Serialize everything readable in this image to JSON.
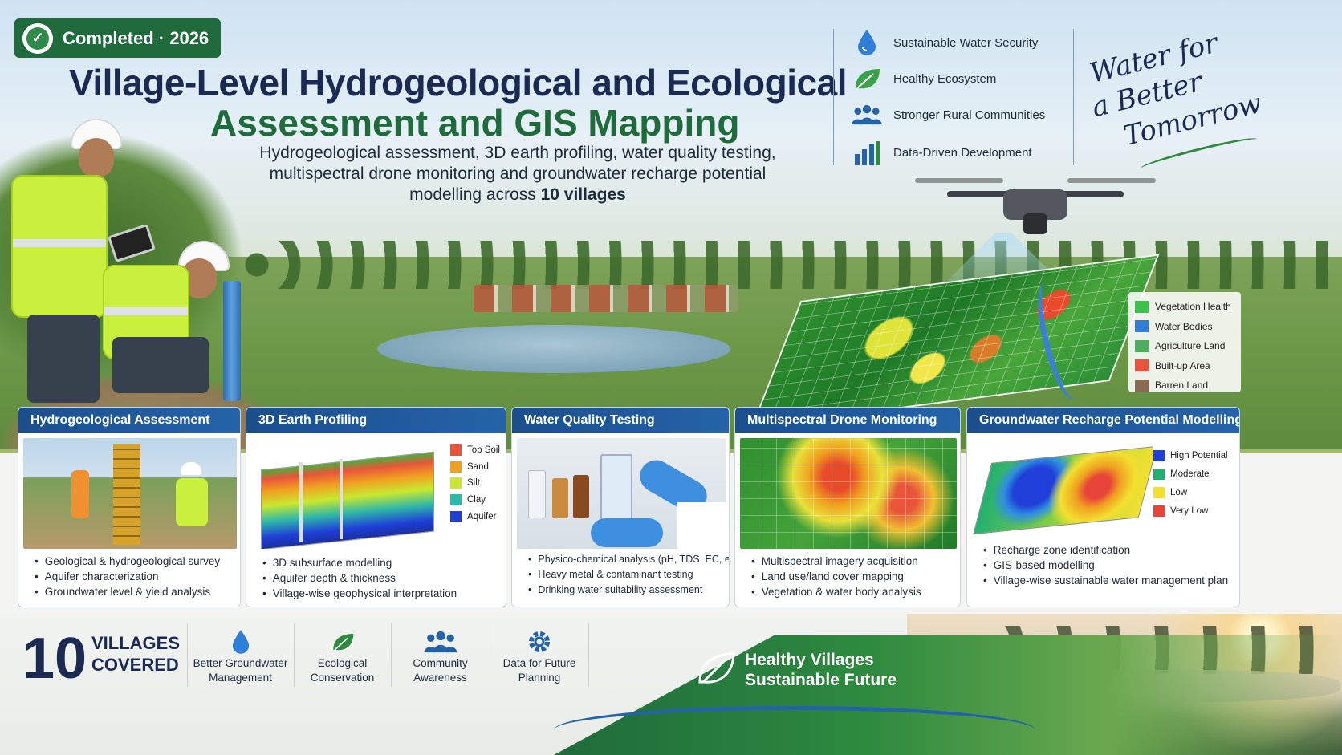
{
  "badge": {
    "text": "Completed · 2026"
  },
  "title": {
    "line1": "Village-Level Hydrogeological and Ecological",
    "line2": "Assessment and GIS Mapping"
  },
  "subtitle": {
    "line1": "Hydrogeological assessment, 3D earth profiling, water quality testing,",
    "line2": "multispectral drone monitoring and groundwater recharge potential",
    "line3_prefix": "modelling across ",
    "line3_bold": "10 villages"
  },
  "goals": [
    {
      "label": "Sustainable Water Security",
      "icon": "water-drop-icon"
    },
    {
      "label": "Healthy Ecosystem",
      "icon": "leaf-icon"
    },
    {
      "label": "Stronger Rural Communities",
      "icon": "people-icon"
    },
    {
      "label": "Data-Driven Development",
      "icon": "bar-chart-icon"
    }
  ],
  "tagline": {
    "l1": "Water for",
    "l2": "a Better",
    "l3": "Tomorrow"
  },
  "map_legend": [
    {
      "label": "Vegetation Health",
      "color": "#3cc24a"
    },
    {
      "label": "Water Bodies",
      "color": "#2f7fd8"
    },
    {
      "label": "Agriculture Land",
      "color": "#4cae5e"
    },
    {
      "label": "Built-up Area",
      "color": "#e8553a"
    },
    {
      "label": "Barren Land",
      "color": "#8b6b4f"
    }
  ],
  "cards": [
    {
      "title": "Hydrogeological Assessment",
      "bullets": [
        "Geological & hydrogeological survey",
        "Aquifer characterization",
        "Groundwater level & yield analysis"
      ]
    },
    {
      "title": "3D Earth Profiling",
      "bullets": [
        "3D subsurface modelling",
        "Aquifer depth & thickness",
        "Village-wise geophysical interpretation"
      ],
      "legend": [
        {
          "label": "Top Soil",
          "color": "#e8553a"
        },
        {
          "label": "Sand",
          "color": "#f0a020"
        },
        {
          "label": "Silt",
          "color": "#c8e830"
        },
        {
          "label": "Clay",
          "color": "#2fb8a8"
        },
        {
          "label": "Aquifer",
          "color": "#1f3fd8"
        }
      ]
    },
    {
      "title": "Water Quality Testing",
      "bullets": [
        "Physico-chemical analysis (pH, TDS, EC, etc.)",
        "Heavy metal & contaminant testing",
        "Drinking water suitability assessment"
      ]
    },
    {
      "title": "Multispectral Drone Monitoring",
      "bullets": [
        "Multispectral imagery acquisition",
        "Land use/land cover mapping",
        "Vegetation & water body analysis"
      ]
    },
    {
      "title": "Groundwater Recharge Potential Modelling",
      "bullets": [
        "Recharge zone identification",
        "GIS-based modelling",
        "Village-wise sustainable water management plan"
      ],
      "legend": [
        {
          "label": "High Potential",
          "color": "#1f3fd8"
        },
        {
          "label": "Moderate",
          "color": "#22b070"
        },
        {
          "label": "Low",
          "color": "#f2e030"
        },
        {
          "label": "Very Low",
          "color": "#e8453a"
        }
      ]
    }
  ],
  "villages": {
    "number": "10",
    "line1": "VILLAGES",
    "line2": "COVERED"
  },
  "benefits": [
    {
      "line1": "Better Groundwater",
      "line2": "Management",
      "icon": "water-drop-icon"
    },
    {
      "line1": "Ecological",
      "line2": "Conservation",
      "icon": "leaf-icon"
    },
    {
      "line1": "Community",
      "line2": "Awareness",
      "icon": "people-icon"
    },
    {
      "line1": "Data for Future",
      "line2": "Planning",
      "icon": "gear-icon"
    }
  ],
  "footer": {
    "line1": "Healthy Villages",
    "line2": "Sustainable Future"
  }
}
